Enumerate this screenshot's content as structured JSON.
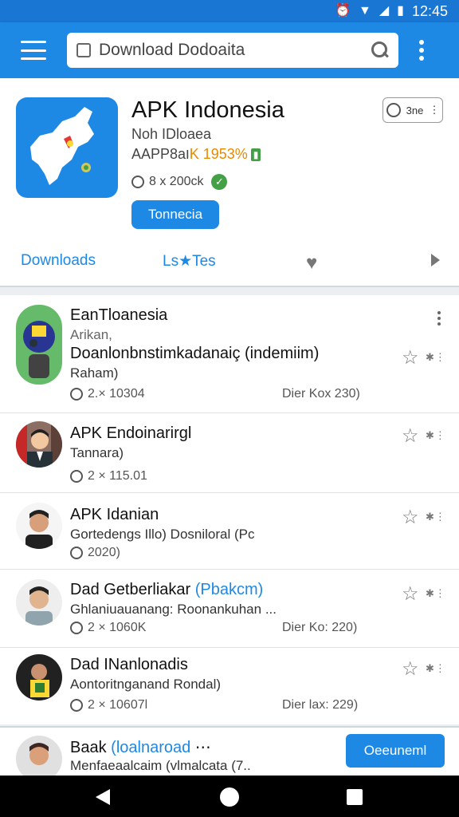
{
  "status": {
    "time": "12:45"
  },
  "search": {
    "placeholder": "Download Dodoaita"
  },
  "header": {
    "title": "APK Indonesia",
    "sub1": "Noh IDloaea",
    "sub2_prefix": "AAPP8aו",
    "sub2_highlight": "K 1953%",
    "stats": "8 x 200ck",
    "primary_button": "Tonnecia",
    "small_button": "3ne"
  },
  "tabs": {
    "downloads": "Downloads",
    "favorites": "Ls★Tes"
  },
  "rows": [
    {
      "title": "EanTloanesia",
      "line1": "Arikan,",
      "line2": "Doanlonbnstimkadanaiç (indemiim)",
      "line3": "Raham)",
      "meta": "2.× 10304",
      "date": "Dier Kox 230)"
    },
    {
      "title": "APK Endoinarirgl",
      "line1": "Tannara)",
      "meta": "2 × 115.01"
    },
    {
      "title": "APK Idanian",
      "line1": "Gortedengs Illo) Dosniloral (Pc",
      "meta": "2020)"
    },
    {
      "title_prefix": "Dad Getberliakar",
      "title_highlight": "(Pbakcm)",
      "line1": "Ghlaniuauanang: Roonankuhan ...",
      "meta": "2 × 1060K",
      "date": "Dier Ko: 220)"
    },
    {
      "title": "Dad INanlonadis",
      "line1": "Aontoritnganand Rondal)",
      "meta": "2 × 10607l",
      "date": "Dier lax: 229)"
    }
  ],
  "bottom": {
    "title_prefix": "Baak",
    "title_highlight": "(loalnaroad",
    "line1": "Menfaeaalcaim (vlmalcata (7..",
    "button": "Oeeuneml"
  },
  "colors": {
    "primary": "#1e88e5",
    "statusbar": "#1976d2"
  }
}
